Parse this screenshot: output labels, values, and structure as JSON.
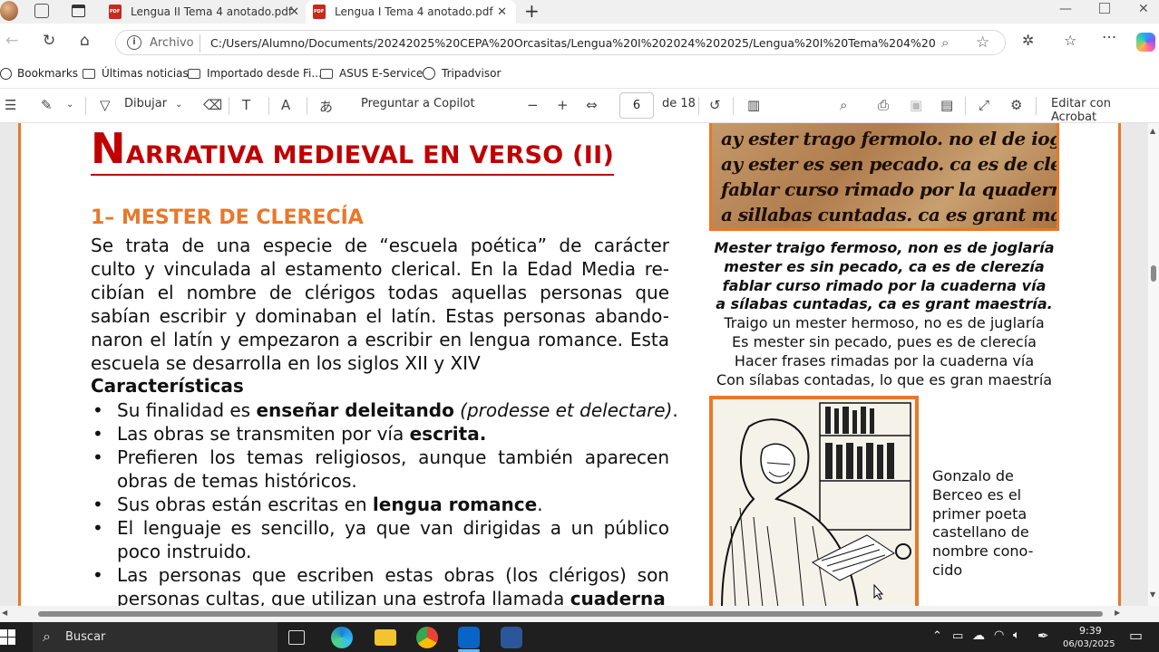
{
  "browser": {
    "tabs": [
      {
        "label": "Lengua II Tema 4 anotado.pdf",
        "active": false
      },
      {
        "label": "Lengua I Tema 4 anotado.pdf",
        "active": true
      }
    ],
    "address": {
      "scheme_label": "Archivo",
      "url": "C:/Users/Alumno/Documents/20242025%20CEPA%20Orcasitas/Lengua%20I%202024%202025/Lengua%20I%20Tema%204%20anota..."
    },
    "bookmarks": [
      {
        "label": "Bookmarks",
        "icon": "bookmark-icon"
      },
      {
        "label": "Últimas noticias",
        "icon": "folder-icon"
      },
      {
        "label": "Importado desde Fi...",
        "icon": "folder-icon"
      },
      {
        "label": "ASUS E-Service",
        "icon": "folder-icon"
      },
      {
        "label": "Tripadvisor",
        "icon": "globe-icon"
      }
    ]
  },
  "pdf_toolbar": {
    "draw_label": "Dibujar",
    "copilot_label": "Preguntar a Copilot",
    "page_current": "6",
    "page_total_label": "de 18",
    "acrobat_label": "Editar con Acrobat"
  },
  "document": {
    "title_first": "N",
    "title_rest": "ARRATIVA MEDIEVAL EN VERSO (II)",
    "section_heading": "1– MESTER DE CLERECÍA",
    "intro_lines": [
      "Se trata de una especie de “escuela poética” de carácter",
      "culto y vinculada al estamento clerical. En la Edad Media re-",
      "cibían el nombre de clérigos todas aquellas personas que",
      "sabían escribir y dominaban el latín. Estas personas abando-",
      "naron el latín y empezaron a escribir en lengua romance. Esta",
      "escuela se desarrolla en los siglos XII y XIV"
    ],
    "characteristics_heading": "Características",
    "bullets": {
      "b1_pre": "Su finalidad es ",
      "b1_bold": "enseñar deleitando",
      "b1_italic": " (prodesse et delectare)",
      "b1_post": ".",
      "b2_pre": "Las obras se transmiten por vía ",
      "b2_bold": "escrita.",
      "b3_line1": "Prefieren los temas religiosos, aunque también aparecen",
      "b3_line2": "obras de temas históricos.",
      "b4_pre": "Sus obras están escritas en ",
      "b4_bold": "lengua romance",
      "b4_post": ".",
      "b5_line1": "El lenguaje es sencillo, ya que van dirigidas a un público",
      "b5_line2": "poco instruido.",
      "b6_line1": "Las personas que escriben estas obras (los clérigos) son",
      "b6_line2_pre": "personas cultas, que utilizan una estrofa llamada ",
      "b6_line2_bold": "cuaderna"
    },
    "manuscript_lines": [
      "ay ester trago fermolo. no el de ioglaria.",
      "ay ester es sen pecado. ca es de clerzia.",
      "fablar curso rimado por la quaderna uia.",
      "a sillabas cuntadas. ca es grant maestria."
    ],
    "verse_old": [
      "Mester traigo fermoso, non es de joglaría",
      "mester es sin pecado, ca es de clerezía",
      "fablar curso rimado por la cuaderna vía",
      "a sílabas cuntadas, ca es grant maestría."
    ],
    "verse_modern": [
      "Traigo un mester hermoso, no es de juglaría",
      "Es mester sin pecado, pues es de clerecía",
      "Hacer frases rimadas por la cuaderna vía",
      "Con sílabas contadas, lo que es gran maestría"
    ],
    "caption": "Gonzalo de Berceo es el primer poeta castellano de nombre cono-cido"
  },
  "taskbar": {
    "search_label": "Buscar",
    "time": "9:39",
    "date": "06/03/2025"
  },
  "colors": {
    "title_red": "#c00000",
    "accent_orange": "#e8782a"
  }
}
